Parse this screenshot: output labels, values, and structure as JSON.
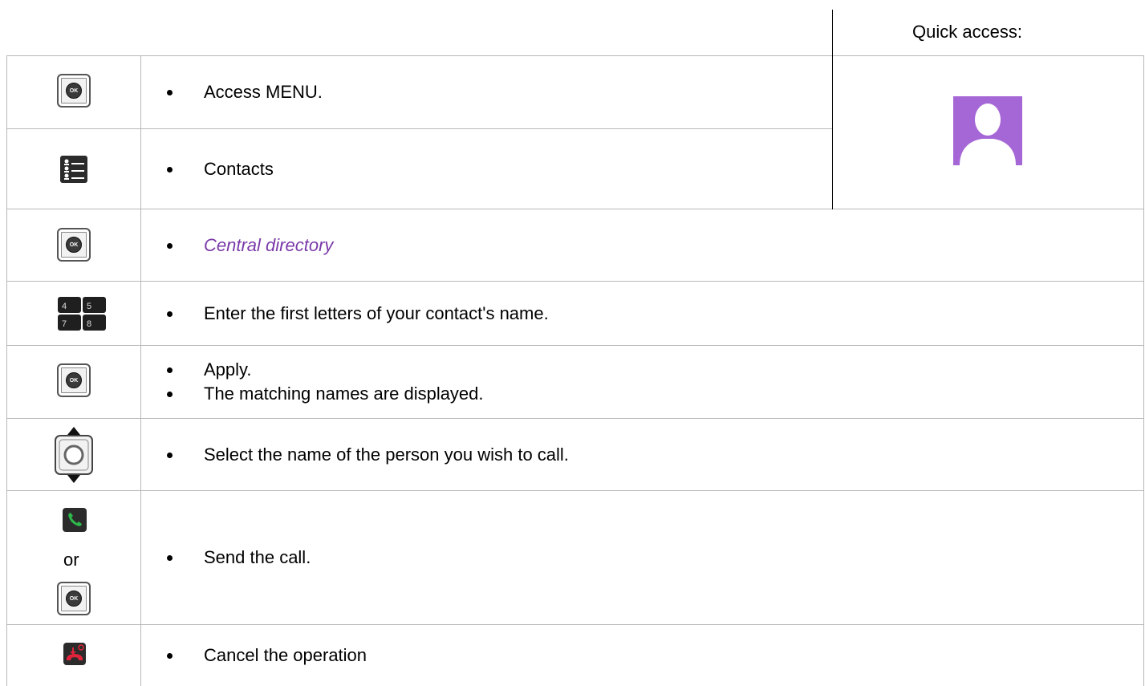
{
  "quick_access": {
    "label": "Quick access:"
  },
  "rows": [
    {
      "icon": "ok-key-icon",
      "items": [
        "Access MENU."
      ]
    },
    {
      "icon": "contacts-list-icon",
      "items": [
        "Contacts"
      ]
    },
    {
      "icon": "ok-key-icon",
      "items": [
        "Central directory"
      ]
    },
    {
      "icon": "numeric-keypad-icon",
      "items": [
        "Enter the first letters of your contact's name."
      ]
    },
    {
      "icon": "ok-key-icon",
      "items": [
        "Apply.",
        "The matching names are displayed."
      ]
    },
    {
      "icon": "navigator-up-down-icon",
      "items": [
        "Select the name of the person you wish to call."
      ]
    },
    {
      "icon": "off-hook-key-icon",
      "alt_icon": "ok-key-icon",
      "or_label": "or",
      "items": [
        "Send the call."
      ]
    },
    {
      "icon": "release-key-icon",
      "items": [
        "Cancel the operation"
      ]
    }
  ],
  "colors": {
    "highlight": "#7a3aa9",
    "grid": "#b8b8b8",
    "avatar": "#a667d6",
    "call_green": "#2db84b",
    "release_red": "#e0233a"
  }
}
